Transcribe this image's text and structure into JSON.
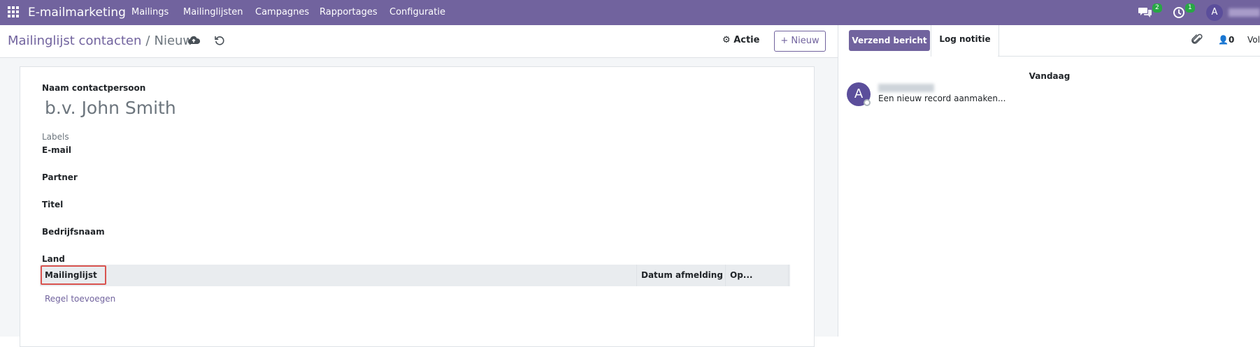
{
  "topbar": {
    "app_name": "E-mailmarketing",
    "menu": [
      "Mailings",
      "Mailinglijsten",
      "Campagnes",
      "Rapportages",
      "Configuratie"
    ],
    "messages_count": "2",
    "activities_count": "1",
    "user_initial": "A"
  },
  "breadcrumb": {
    "parent": "Mailinglijst contacten",
    "separator": "/",
    "current": "Nieuw"
  },
  "control": {
    "action_label": "Actie",
    "new_label": "Nieuw"
  },
  "form": {
    "name_label": "Naam contactpersoon",
    "name_placeholder": "b.v. John Smith",
    "labels_placeholder": "Labels",
    "fields": [
      "E-mail",
      "Partner",
      "Titel",
      "Bedrijfsnaam",
      "Land"
    ],
    "table": {
      "columns": [
        "Mailinglijst",
        "Datum afmelding",
        "Op..."
      ],
      "add_line": "Regel toevoegen"
    }
  },
  "chatter": {
    "send_label": "Verzend bericht",
    "log_label": "Log notitie",
    "followers_count": "0",
    "follow_label": "Vol",
    "date_separator": "Vandaag",
    "message": {
      "initial": "A",
      "text": "Een nieuw record aanmaken..."
    }
  },
  "colors": {
    "brand": "#71639e",
    "badge": "#28a745",
    "highlight": "#d9534f"
  }
}
